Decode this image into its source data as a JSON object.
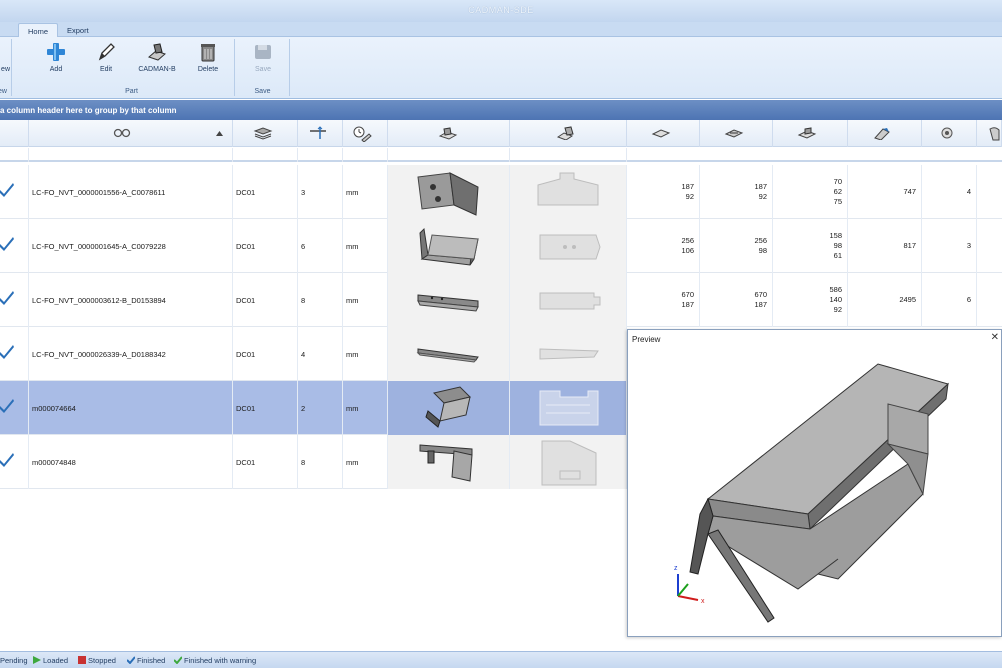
{
  "window": {
    "title": "CADMAN-SDE"
  },
  "tabs": [
    {
      "label": "Home"
    },
    {
      "label": "Export"
    }
  ],
  "ribbon": {
    "view_label": "ew",
    "view_group": "ew",
    "part_group": "Part",
    "save_group": "Save",
    "add": "Add",
    "edit": "Edit",
    "cadman_b": "CADMAN-B",
    "delete": "Delete",
    "save": "Save"
  },
  "group_by_hint": "a column header here to group by that column",
  "rows": [
    {
      "name": "LC-FO_NVT_0000001556-A_C0078611",
      "material": "DC01",
      "thickness": "3",
      "unit": "mm",
      "c1": [
        "187",
        "92"
      ],
      "c2": [
        "187",
        "92"
      ],
      "c3": [
        "70",
        "62",
        "75"
      ],
      "c4": "747",
      "c5": "4"
    },
    {
      "name": "LC-FO_NVT_0000001645-A_C0079228",
      "material": "DC01",
      "thickness": "6",
      "unit": "mm",
      "c1": [
        "256",
        "106"
      ],
      "c2": [
        "256",
        "98"
      ],
      "c3": [
        "158",
        "98",
        "61"
      ],
      "c4": "817",
      "c5": "3"
    },
    {
      "name": "LC-FO_NVT_0000003612-B_D0153894",
      "material": "DC01",
      "thickness": "8",
      "unit": "mm",
      "c1": [
        "670",
        "187"
      ],
      "c2": [
        "670",
        "187"
      ],
      "c3": [
        "586",
        "140",
        "92"
      ],
      "c4": "2495",
      "c5": "6"
    },
    {
      "name": "LC-FO_NVT_0000026339-A_D0188342",
      "material": "DC01",
      "thickness": "4",
      "unit": "mm"
    },
    {
      "name": "m000074664",
      "material": "DC01",
      "thickness": "2",
      "unit": "mm"
    },
    {
      "name": "m000074848",
      "material": "DC01",
      "thickness": "8",
      "unit": "mm"
    }
  ],
  "preview": {
    "title": "Preview",
    "close": "✕",
    "axis_x": "x",
    "axis_z": "z"
  },
  "status": {
    "pending": "Pending",
    "loaded": "Loaded",
    "stopped": "Stopped",
    "finished": "Finished",
    "finished_warning": "Finished with warning"
  },
  "colors": {
    "ribbon": "#dce9f8",
    "selected_row": "#a9bce6",
    "groupbar": "#4d74b3",
    "check": "#2a6fb8"
  }
}
